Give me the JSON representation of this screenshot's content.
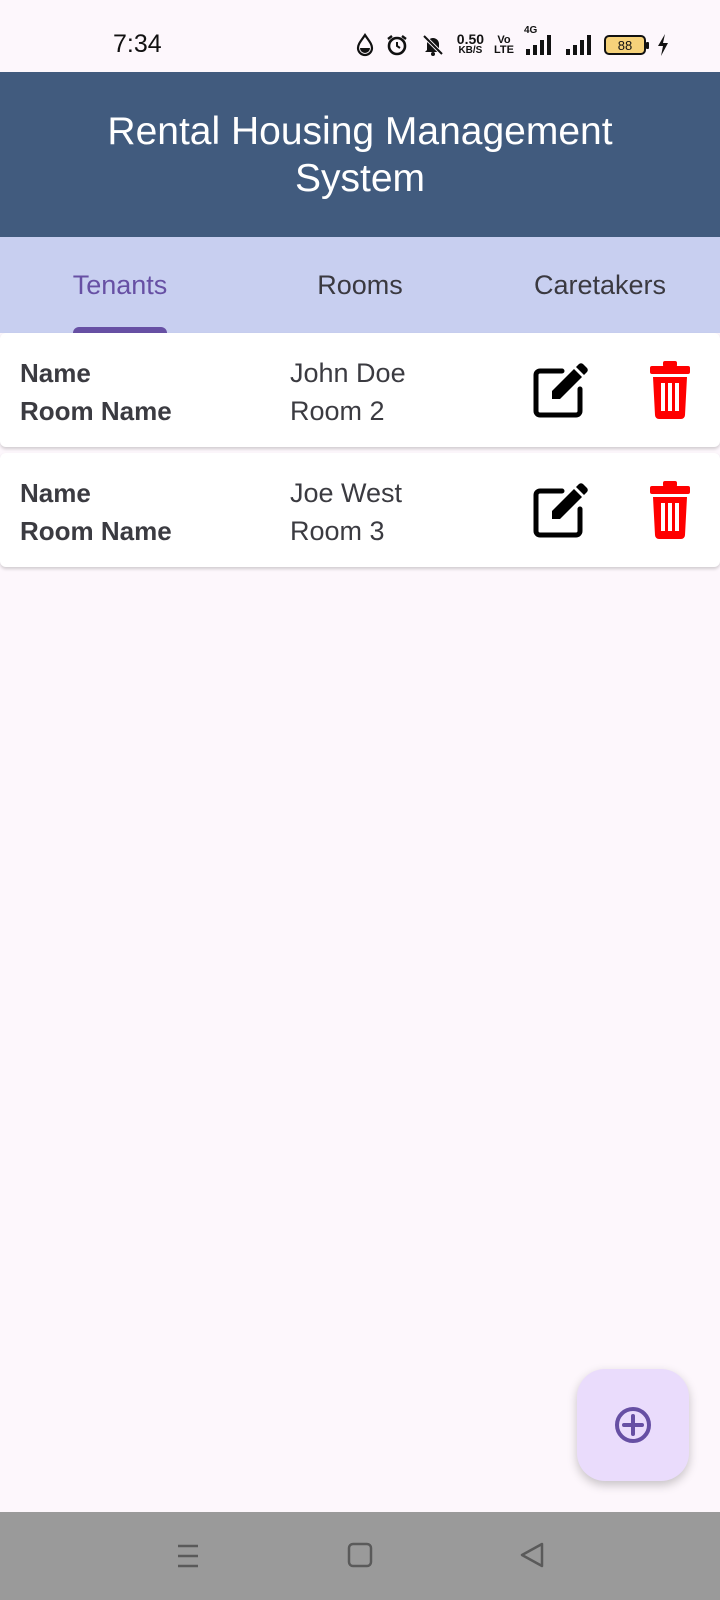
{
  "status_bar": {
    "time": "7:34",
    "speed_value": "0.50",
    "speed_unit": "KB/S",
    "volte_top": "Vo",
    "volte_bottom": "LTE",
    "network": "4G",
    "battery": "88"
  },
  "app_bar": {
    "title": "Rental Housing Management System"
  },
  "tabs": [
    {
      "label": "Tenants",
      "active": true
    },
    {
      "label": "Rooms",
      "active": false
    },
    {
      "label": "Caretakers",
      "active": false
    }
  ],
  "tenants": [
    {
      "name_label": "Name",
      "room_label": "Room Name",
      "name": "John Doe",
      "room": "Room 2"
    },
    {
      "name_label": "Name",
      "room_label": "Room Name",
      "name": "Joe West",
      "room": "Room 3"
    }
  ],
  "icons": {
    "edit": "edit-icon",
    "delete": "trash-icon",
    "add": "add-circle-icon"
  },
  "colors": {
    "app_bar": "#415b7e",
    "tab_bar": "#c8cff0",
    "accent": "#6750a4",
    "delete": "#ff0000",
    "fab": "#eadcfc"
  }
}
